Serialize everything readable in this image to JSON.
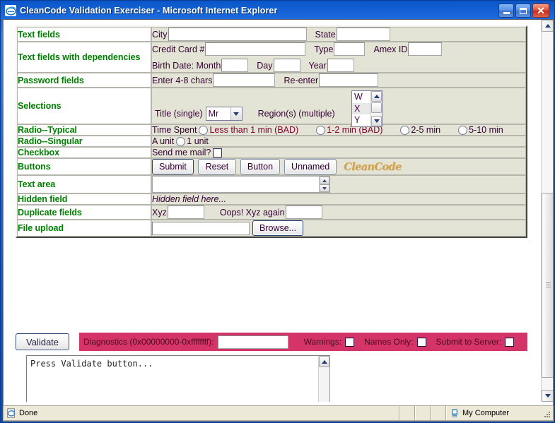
{
  "window": {
    "title": "CleanCode Validation Exerciser - Microsoft Internet Explorer",
    "minimize_label": "Minimize",
    "maximize_label": "Maximize",
    "close_label": "Close"
  },
  "form_rows": [
    {
      "label": "Text fields",
      "fields": [
        [
          {
            "kind": "label",
            "text": "City"
          },
          {
            "kind": "input",
            "value": "",
            "width": "w-city",
            "name": "city-input"
          },
          {
            "kind": "gap"
          },
          {
            "kind": "label",
            "text": "State"
          },
          {
            "kind": "input",
            "value": "",
            "width": "w-state",
            "name": "state-input"
          }
        ]
      ]
    },
    {
      "label": "Text fields with dependencies",
      "fields": [
        [
          {
            "kind": "label",
            "text": "Credit Card #"
          },
          {
            "kind": "input",
            "value": "",
            "width": "w-cc",
            "name": "credit-card-input"
          },
          {
            "kind": "gap"
          },
          {
            "kind": "label",
            "text": "Type"
          },
          {
            "kind": "input",
            "value": "",
            "width": "w-type",
            "name": "card-type-input"
          },
          {
            "kind": "gap"
          },
          {
            "kind": "label",
            "text": "Amex ID"
          },
          {
            "kind": "input",
            "value": "",
            "width": "w-amex",
            "name": "amex-id-input"
          }
        ],
        [
          {
            "kind": "label",
            "text": "Birth Date: Month"
          },
          {
            "kind": "input",
            "value": "",
            "width": "w-date",
            "name": "birth-month-input"
          },
          {
            "kind": "gap"
          },
          {
            "kind": "label",
            "text": "Day"
          },
          {
            "kind": "input",
            "value": "",
            "width": "w-date",
            "name": "birth-day-input"
          },
          {
            "kind": "gap"
          },
          {
            "kind": "label",
            "text": "Year"
          },
          {
            "kind": "input",
            "value": "",
            "width": "w-date",
            "name": "birth-year-input"
          }
        ]
      ]
    },
    {
      "label": "Password fields",
      "fields": [
        [
          {
            "kind": "label",
            "text": "Enter 4-8 chars"
          },
          {
            "kind": "input",
            "value": "",
            "width": "w-pass",
            "name": "password-input"
          },
          {
            "kind": "gap"
          },
          {
            "kind": "label",
            "text": "Re-enter"
          },
          {
            "kind": "input",
            "value": "",
            "width": "w-pass2",
            "name": "password-confirm-input"
          }
        ]
      ]
    },
    {
      "label": "Radio--Typical",
      "fields": [
        [
          {
            "kind": "label",
            "text": "Time Spent"
          },
          {
            "kind": "radio",
            "name": "time-spent-radio-1"
          },
          {
            "kind": "label",
            "text": "Less than 1 min (BAD)",
            "cls": "bad"
          },
          {
            "kind": "gap-lg"
          },
          {
            "kind": "radio",
            "name": "time-spent-radio-2"
          },
          {
            "kind": "label",
            "text": "1-2 min (BAD)",
            "cls": "bad"
          },
          {
            "kind": "gap-lg"
          },
          {
            "kind": "radio",
            "name": "time-spent-radio-3"
          },
          {
            "kind": "label",
            "text": "2-5 min"
          },
          {
            "kind": "gap-lg"
          },
          {
            "kind": "radio",
            "name": "time-spent-radio-4"
          },
          {
            "kind": "label",
            "text": "5-10 min"
          }
        ]
      ]
    },
    {
      "label": "Radio--Singular",
      "fields": [
        [
          {
            "kind": "label",
            "text": "A unit"
          },
          {
            "kind": "radio",
            "name": "a-unit-radio"
          },
          {
            "kind": "label",
            "text": "1 unit"
          }
        ]
      ]
    },
    {
      "label": "Checkbox",
      "fields": [
        [
          {
            "kind": "label",
            "text": "Send me mail?"
          },
          {
            "kind": "checkbox",
            "name": "send-mail-checkbox"
          }
        ]
      ]
    },
    {
      "label": "Hidden field",
      "fields": [
        [
          {
            "kind": "italic",
            "text": "Hidden field here..."
          }
        ]
      ]
    },
    {
      "label": "Duplicate fields",
      "fields": [
        [
          {
            "kind": "label",
            "text": "Xyz"
          },
          {
            "kind": "input",
            "value": "",
            "width": "w-xyz",
            "name": "xyz-input"
          },
          {
            "kind": "gap-lg"
          },
          {
            "kind": "label",
            "text": "Oops! Xyz again"
          },
          {
            "kind": "input",
            "value": "",
            "width": "w-xyz",
            "name": "xyz-again-input"
          }
        ]
      ]
    }
  ],
  "selections": {
    "row_label": "Selections",
    "single_label": "Title (single)",
    "single_value": "Mr",
    "multiple_label": "Region(s) (multiple)",
    "multiple_options": [
      "W",
      "X",
      "Y"
    ]
  },
  "buttons_row": {
    "row_label": "Buttons",
    "buttons": [
      "Submit",
      "Reset",
      "Button",
      "Unnamed"
    ],
    "logo_text": "CleanCode"
  },
  "textarea_row": {
    "row_label": "Text area",
    "value": ""
  },
  "file_row": {
    "row_label": "File upload",
    "value": "",
    "browse_label": "Browse..."
  },
  "validate_bar": {
    "validate_label": "Validate",
    "diagnostics_label": "Diagnostics (0x00000000-0xffffffff):",
    "diagnostics_value": "",
    "warnings_label": "Warnings:",
    "names_only_label": "Names Only:",
    "submit_to_server_label": "Submit to Server:",
    "strip_color": "#d43468"
  },
  "output": {
    "text": "Press Validate button..."
  },
  "statusbar": {
    "status_text": "Done",
    "zone_text": "My Computer"
  }
}
